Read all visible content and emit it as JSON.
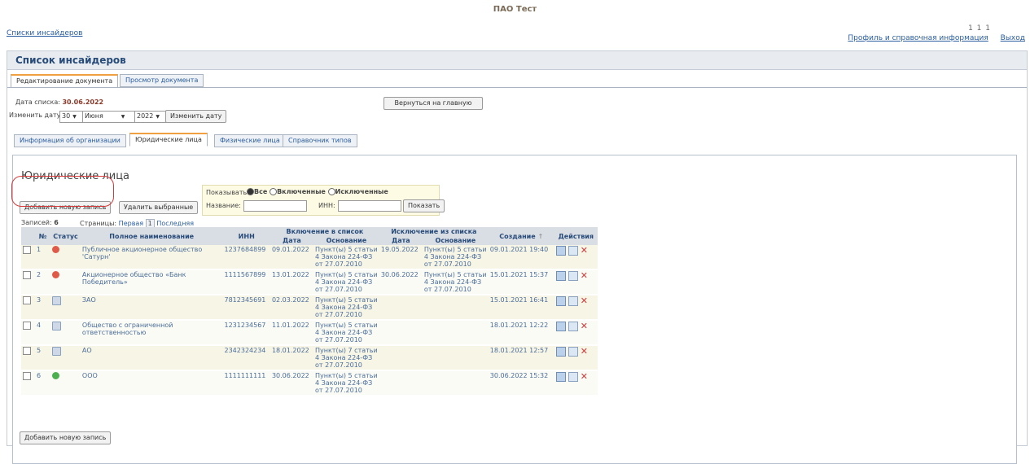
{
  "header": {
    "org_name": "ПАО Тест",
    "breadcrumb": "Списки инсайдеров",
    "user_code": "1 1 1",
    "profile_link": "Профиль и справочная информация",
    "logout_link": "Выход"
  },
  "page": {
    "title": "Список инсайдеров",
    "doc_tabs": [
      "Редактирование документа",
      "Просмотр документа"
    ],
    "list_date_label": "Дата списка:",
    "list_date_value": "30.06.2022",
    "change_date_label": "Изменить дату:",
    "day_value": "30",
    "month_value": "Июня",
    "year_value": "2022",
    "change_date_button": "Изменить дату",
    "back_button": "Вернуться на главную",
    "section_tabs": [
      "Информация об организации",
      "Юридические лица",
      "Физические лица",
      "Справочник типов"
    ]
  },
  "section": {
    "title": "Юридические лица",
    "add_button": "Добавить новую запись",
    "delete_button": "Удалить выбранные",
    "show_label": "Показывать:",
    "filter_all": "Все",
    "filter_included": "Включенные",
    "filter_excluded": "Исключенные",
    "name_label": "Название:",
    "inn_label": "ИНН:",
    "show_button": "Показать",
    "records_label": "Записей:",
    "records_count": "6",
    "pages_label": "Страницы:",
    "first_page": "Первая",
    "current_page": "1",
    "last_page": "Последняя"
  },
  "table": {
    "headers": {
      "num": "№",
      "status": "Статус",
      "full_name": "Полное наименование",
      "inn": "ИНН",
      "inclusion": "Включение в список",
      "exclusion": "Исключение из списка",
      "date": "Дата",
      "basis": "Основание",
      "created": "Создание",
      "actions": "Действия"
    },
    "rows": [
      {
        "num": "1",
        "status": "red",
        "name": "Публичное акционерное общество 'Сатурн'",
        "inn": "1237684899",
        "inc_date": "09.01.2022",
        "inc_basis": "Пункт(ы) 5 статьи 4 Закона 224-ФЗ от 27.07.2010",
        "exc_date": "19.05.2022",
        "exc_basis": "Пункт(ы) 5 статьи 4 Закона 224-ФЗ от 27.07.2010",
        "created": "09.01.2021 19:40"
      },
      {
        "num": "2",
        "status": "red",
        "name": "Акционерное общество «Банк Победитель»",
        "inn": "1111567899",
        "inc_date": "13.01.2022",
        "inc_basis": "Пункт(ы) 5 статьи 4 Закона 224-ФЗ от 27.07.2010",
        "exc_date": "30.06.2022",
        "exc_basis": "Пункт(ы) 5 статьи 4 Закона 224-ФЗ от 27.07.2010",
        "created": "15.01.2021 15:37"
      },
      {
        "num": "3",
        "status": "doc",
        "name": "ЗАО",
        "inn": "7812345691",
        "inc_date": "02.03.2022",
        "inc_basis": "Пункт(ы) 5 статьи 4 Закона 224-ФЗ от 27.07.2010",
        "exc_date": "",
        "exc_basis": "",
        "created": "15.01.2021 16:41"
      },
      {
        "num": "4",
        "status": "doc",
        "name": "Общество с ограниченной ответственностью",
        "inn": "1231234567",
        "inc_date": "11.01.2022",
        "inc_basis": "Пункт(ы) 5 статьи 4 Закона 224-ФЗ от 27.07.2010",
        "exc_date": "",
        "exc_basis": "",
        "created": "18.01.2021 12:22"
      },
      {
        "num": "5",
        "status": "doc",
        "name": "АО",
        "inn": "2342324234",
        "inc_date": "18.01.2022",
        "inc_basis": "Пункт(ы) 7 статьи 4 Закона 224-ФЗ от 27.07.2010",
        "exc_date": "",
        "exc_basis": "",
        "created": "18.01.2021 12:57"
      },
      {
        "num": "6",
        "status": "green",
        "name": "ООО",
        "inn": "1111111111",
        "inc_date": "30.06.2022",
        "inc_basis": "Пункт(ы) 5 статьи 4 Закона 224-ФЗ от 27.07.2010",
        "exc_date": "",
        "exc_basis": "",
        "created": "30.06.2022 15:32"
      }
    ]
  },
  "icons": {
    "status_red": "minus-circle-icon",
    "status_green": "plus-circle-icon",
    "status_doc": "document-icon",
    "edit": "edit-icon",
    "view": "view-icon",
    "delete": "delete-icon"
  }
}
